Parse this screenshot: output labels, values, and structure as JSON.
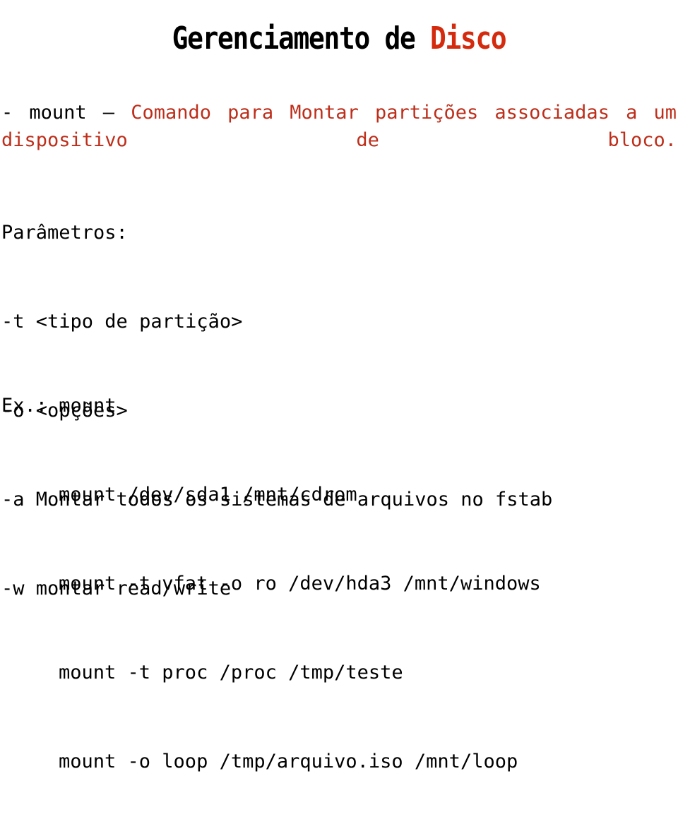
{
  "slide": {
    "title": {
      "black_part": "Gerenciamento de ",
      "red_part": "Disco"
    },
    "intro": {
      "black_part": "- mount – ",
      "red_part": "Comando para Montar partições associadas a um dispositivo de bloco."
    },
    "parameters": {
      "heading": "Parâmetros:",
      "items": [
        "-t <tipo de partição>",
        "-o <opções>",
        "-a Montar todos os sistemas de arquivos no fstab",
        "-w montar read/write"
      ]
    },
    "examples": {
      "heading": "Ex.: mount",
      "commands": [
        "mount /dev/sda1 /mnt/cdrom",
        "mount -t vfat -o ro /dev/hda3 /mnt/windows",
        "mount -t proc /proc /tmp/teste",
        "mount -o loop /tmp/arquivo.iso /mnt/loop"
      ]
    },
    "colors": {
      "title_red": "#D42A0E",
      "body_red": "#BE2E1A",
      "text_black": "#000000",
      "background": "#FFFFFF"
    }
  }
}
